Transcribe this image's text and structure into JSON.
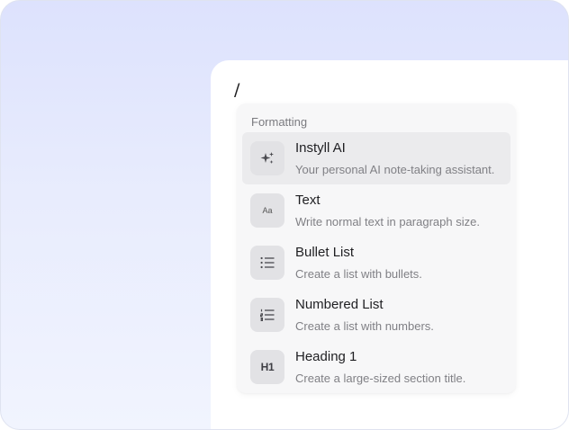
{
  "editor": {
    "typed_text": "/"
  },
  "menu": {
    "section_label": "Formatting",
    "items": [
      {
        "title": "Instyll AI",
        "description": "Your personal AI note-taking assistant.",
        "icon": "sparkles-icon",
        "active": true
      },
      {
        "title": "Text",
        "description": "Write normal text in paragraph size.",
        "icon": "text-icon",
        "icon_text": "Aa"
      },
      {
        "title": "Bullet List",
        "description": "Create a list with bullets.",
        "icon": "bullet-list-icon"
      },
      {
        "title": "Numbered List",
        "description": "Create a list with numbers.",
        "icon": "numbered-list-icon"
      },
      {
        "title": "Heading 1",
        "description": "Create a large-sized section title.",
        "icon": "heading-icon",
        "icon_text": "H1"
      }
    ]
  }
}
